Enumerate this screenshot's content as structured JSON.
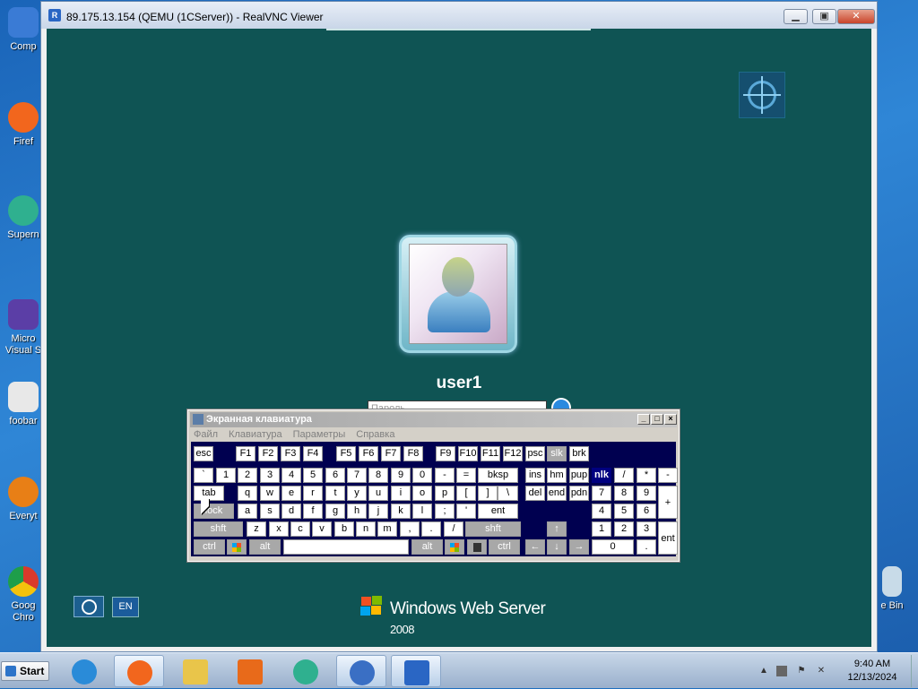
{
  "desktop": {
    "icons": [
      {
        "label": "Comp",
        "icon": "computer-icon",
        "color": "#3a7bd5"
      },
      {
        "label": "Firef",
        "icon": "firefox-icon",
        "color": "#f2661d"
      },
      {
        "label": "Supern",
        "icon": "supernova-icon",
        "color": "#2fb08f"
      },
      {
        "label": "Micro\nVisual S",
        "icon": "visual-studio-icon",
        "color": "#5b3ea6"
      },
      {
        "label": "foobar",
        "icon": "foobar-icon",
        "color": "#e8e8e8"
      },
      {
        "label": "Everyt",
        "icon": "everything-icon",
        "color": "#e87f16"
      },
      {
        "label": "Goog\nChro",
        "icon": "chrome-icon",
        "color": "#d93a2b"
      }
    ],
    "recycle_label": "e Bin"
  },
  "vnc_window": {
    "title": "89.175.13.154 (QEMU (1CServer)) - RealVNC Viewer",
    "app_icon_text": "R"
  },
  "remote": {
    "username": "user1",
    "password_placeholder": "Пароль",
    "lang": "EN",
    "brand": "Windows Web Server",
    "brand_year": "2008"
  },
  "osk": {
    "title": "Экранная клавиатура",
    "menu": [
      "Файл",
      "Клавиатура",
      "Параметры",
      "Справка"
    ],
    "row1": [
      "esc",
      "F1",
      "F2",
      "F3",
      "F4",
      "F5",
      "F6",
      "F7",
      "F8",
      "F9",
      "F10",
      "F11",
      "F12",
      "psc",
      "slk",
      "brk"
    ],
    "row2": [
      "`",
      "1",
      "2",
      "3",
      "4",
      "5",
      "6",
      "7",
      "8",
      "9",
      "0",
      "-",
      "=",
      "bksp",
      "ins",
      "hm",
      "pup",
      "nlk",
      "/",
      "*",
      "-"
    ],
    "row3": [
      "tab",
      "q",
      "w",
      "e",
      "r",
      "t",
      "y",
      "u",
      "i",
      "o",
      "p",
      "[",
      "]",
      "\\",
      "del",
      "end",
      "pdn",
      "7",
      "8",
      "9",
      "+"
    ],
    "row4": [
      "lock",
      "a",
      "s",
      "d",
      "f",
      "g",
      "h",
      "j",
      "k",
      "l",
      ";",
      "'",
      "ent",
      "4",
      "5",
      "6"
    ],
    "row5": [
      "shft",
      "z",
      "x",
      "c",
      "v",
      "b",
      "n",
      "m",
      ",",
      ".",
      "/",
      "shft",
      "↑",
      "1",
      "2",
      "3",
      "ent"
    ],
    "row6": [
      "ctrl",
      "win",
      "alt",
      "",
      "alt",
      "win",
      "menu",
      "ctrl",
      "←",
      "↓",
      "→",
      "0",
      "."
    ]
  },
  "taskbar": {
    "start_label": "Start",
    "items": [
      {
        "icon": "ie-icon",
        "color": "#2a8bd8"
      },
      {
        "icon": "firefox-icon",
        "color": "#f2661d"
      },
      {
        "icon": "explorer-icon",
        "color": "#e9c54a"
      },
      {
        "icon": "media-player-icon",
        "color": "#e86a1a"
      },
      {
        "icon": "supernova-icon",
        "color": "#2fb08f"
      },
      {
        "icon": "app-icon",
        "color": "#3a6fc4"
      },
      {
        "icon": "vnc-icon",
        "color": "#2a66c4"
      }
    ],
    "time": "9:40 AM",
    "date": "12/13/2024"
  }
}
